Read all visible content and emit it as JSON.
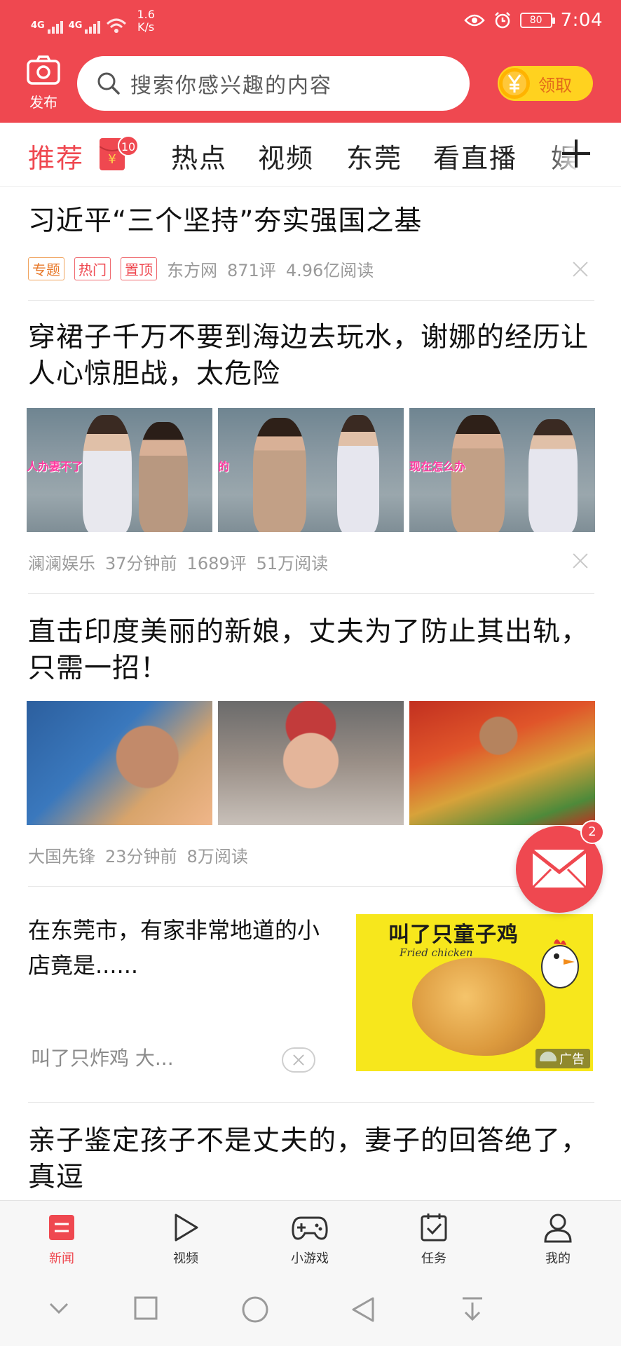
{
  "status_bar": {
    "network_1": "4G",
    "network_2": "4G",
    "speed_value": "1.6",
    "speed_unit": "K/s",
    "battery": "80",
    "time": "7:04"
  },
  "header": {
    "publish_label": "发布",
    "search_placeholder": "搜索你感兴趣的内容",
    "coin_button_label": "领取",
    "brand_color": "#ef4850"
  },
  "tabs": [
    {
      "label": "推荐",
      "active": true
    },
    {
      "label": "热点",
      "active": false
    },
    {
      "label": "视频",
      "active": false
    },
    {
      "label": "东莞",
      "active": false
    },
    {
      "label": "看直播",
      "active": false
    },
    {
      "label": "娱乐",
      "active": false
    }
  ],
  "red_envelope_badge": "10",
  "articles": [
    {
      "title": "习近平“三个坚持”夯实强国之基",
      "tags": [
        "专题",
        "热门",
        "置顶"
      ],
      "source": "东方网",
      "comments": "871评",
      "reads": "4.96亿阅读"
    },
    {
      "title": "穿裙子千万不要到海边去玩水，谢娜的经历让人心惊胆战，太危险",
      "captions": [
        "人办妻不了",
        "的",
        "现在怎么办"
      ],
      "source": "澜澜娱乐",
      "time": "37分钟前",
      "comments": "1689评",
      "reads": "51万阅读"
    },
    {
      "title": "直击印度美丽的新娘，丈夫为了防止其出轨，只需一招！",
      "source": "大国先锋",
      "time": "23分钟前",
      "reads": "8万阅读"
    },
    {
      "title": "亲子鉴定孩子不是丈夫的，妻子的回答绝了，真逗"
    }
  ],
  "ad": {
    "title": "在东莞市，有家非常地道的小店竟是......",
    "source": "叫了只炸鸡 大...",
    "image_brand": "叫了只童子鸡",
    "image_subtitle": "Fried chicken",
    "ad_label": "广告"
  },
  "mail_badge": "2",
  "bottom_nav": [
    {
      "label": "新闻",
      "icon": "news-icon",
      "active": true
    },
    {
      "label": "视频",
      "icon": "play-icon",
      "active": false
    },
    {
      "label": "小游戏",
      "icon": "gamepad-icon",
      "active": false
    },
    {
      "label": "任务",
      "icon": "task-icon",
      "active": false
    },
    {
      "label": "我的",
      "icon": "user-icon",
      "active": false
    }
  ]
}
